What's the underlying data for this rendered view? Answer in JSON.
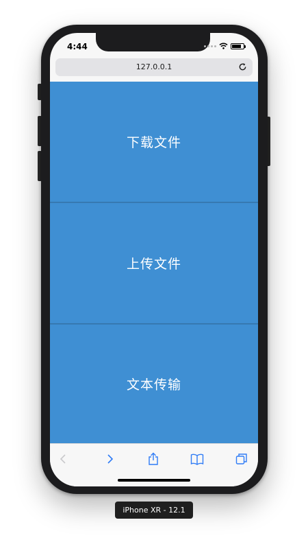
{
  "status_bar": {
    "time": "4:44"
  },
  "browser": {
    "url": "127.0.0.1"
  },
  "panels": [
    {
      "label": "下载文件"
    },
    {
      "label": "上传文件"
    },
    {
      "label": "文本传输"
    }
  ],
  "toolbar": {
    "icons": [
      "back-icon",
      "forward-icon",
      "share-icon",
      "bookmarks-icon",
      "tabs-icon"
    ]
  },
  "device": {
    "label": "iPhone XR - 12.1"
  },
  "colors": {
    "panel_blue": "#3f8fd3",
    "divider_blue": "#3679b1",
    "toolbar_icon_blue": "#2f7cf6"
  }
}
